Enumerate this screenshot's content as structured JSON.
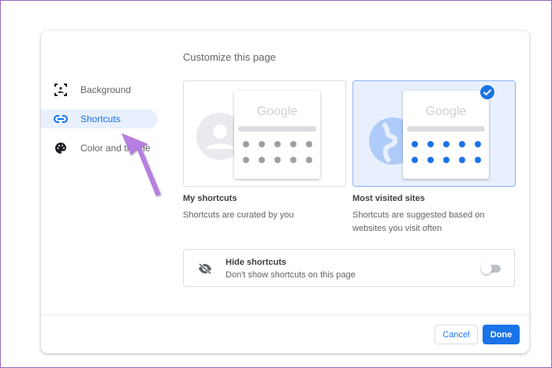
{
  "dialog": {
    "title": "Customize this page"
  },
  "sidebar": {
    "items": [
      {
        "label": "Background",
        "icon": "image-icon"
      },
      {
        "label": "Shortcuts",
        "icon": "link-icon"
      },
      {
        "label": "Color and theme",
        "icon": "palette-icon"
      }
    ]
  },
  "options": [
    {
      "label": "My shortcuts",
      "description": "Shortcuts are curated by you",
      "preview_logo": "Google",
      "selected": false
    },
    {
      "label": "Most visited sites",
      "description": "Shortcuts are suggested based on websites you visit often",
      "preview_logo": "Google",
      "selected": true
    }
  ],
  "hide": {
    "title": "Hide shortcuts",
    "description": "Don't show shortcuts on this page",
    "enabled": false
  },
  "buttons": {
    "cancel": "Cancel",
    "done": "Done"
  },
  "colors": {
    "accent": "#1a73e8",
    "annotation_arrow": "#b57ee0"
  }
}
